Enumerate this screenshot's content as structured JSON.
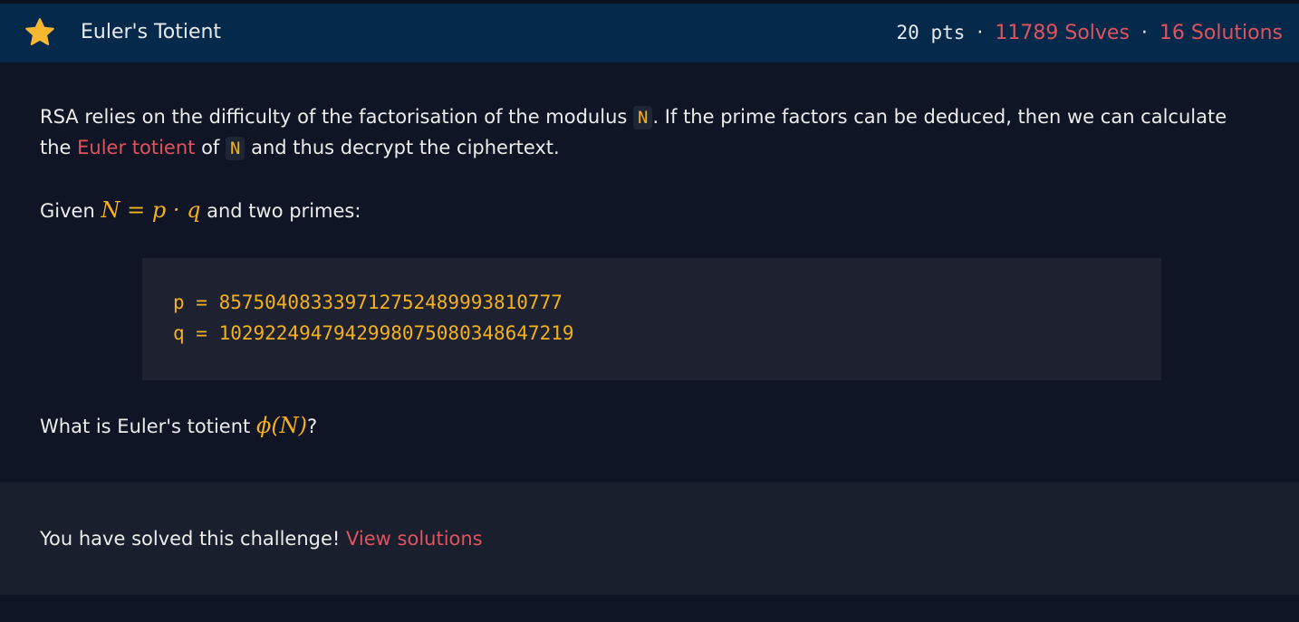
{
  "header": {
    "title": "Euler's Totient",
    "points": "20 pts",
    "solves_link": "11789 Solves",
    "solutions_link": "16 Solutions",
    "separator": "·",
    "star_icon": "star-icon",
    "star_color": "#f7b731"
  },
  "description": {
    "p1_a": "RSA relies on the difficulty of the factorisation of the modulus ",
    "p1_code": "N",
    "p1_b": ". If the prime factors can be deduced, then we can calculate",
    "p1_c": "the ",
    "p1_link": "Euler totient",
    "p1_d": " of ",
    "p1_code2": "N",
    "p1_e": " and thus decrypt the ciphertext.",
    "p2_a": "Given ",
    "p2_math": "N = p · q",
    "p2_b": " and two primes:"
  },
  "code": {
    "line1": "p = 857504083339712752489993810777",
    "line2": "q = 1029224947942998075080348647219"
  },
  "question": {
    "text_a": "What is Euler's totient ",
    "math": "ϕ(N)",
    "text_b": "?"
  },
  "solved": {
    "text": "You have solved this challenge! ",
    "link": "View solutions"
  },
  "colors": {
    "header_bg": "#05294b",
    "accent_link": "#e0525d",
    "code_text": "#f4b11c",
    "page_bg": "#0f1524",
    "panel_bg": "#1a1f2d"
  }
}
